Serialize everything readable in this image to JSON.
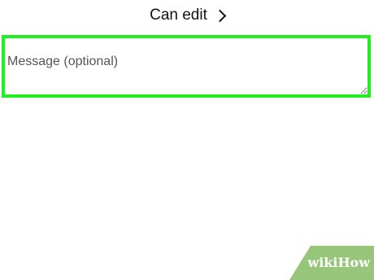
{
  "permission": {
    "label": "Can edit",
    "chevron_icon": "chevron-right-icon"
  },
  "message": {
    "placeholder": "Message (optional)",
    "value": "",
    "highlight_color": "#22ee22"
  },
  "watermark": {
    "text": "wikiHow",
    "color": "#8cbf6a"
  }
}
